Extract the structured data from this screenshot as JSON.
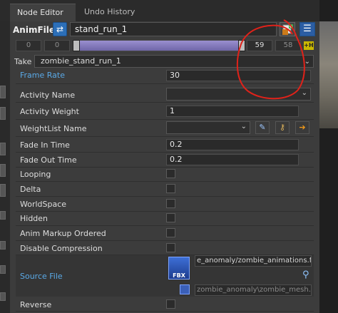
{
  "tabs": [
    {
      "label": "Node Editor"
    },
    {
      "label": "Undo History"
    }
  ],
  "anim": {
    "label": "AnimFile",
    "name": "stand_run_1"
  },
  "timeline": {
    "start_a": "0",
    "start_b": "0",
    "end_a": "59",
    "end_b": "58",
    "badge": "+H"
  },
  "take": {
    "label": "Take",
    "value": "zombie_stand_run_1"
  },
  "properties": {
    "frame_rate": {
      "label": "Frame Rate",
      "value": "30"
    },
    "activity_name": {
      "label": "Activity Name",
      "value": ""
    },
    "activity_weight": {
      "label": "Activity Weight",
      "value": "1"
    },
    "weightlist_name": {
      "label": "WeightList Name",
      "value": ""
    },
    "fade_in_time": {
      "label": "Fade In Time",
      "value": "0.2"
    },
    "fade_out_time": {
      "label": "Fade Out Time",
      "value": "0.2"
    },
    "looping": {
      "label": "Looping"
    },
    "delta": {
      "label": "Delta"
    },
    "worldspace": {
      "label": "WorldSpace"
    },
    "hidden": {
      "label": "Hidden"
    },
    "anim_markup_ordered": {
      "label": "Anim Markup Ordered"
    },
    "disable_compression": {
      "label": "Disable Compression"
    },
    "source_file": {
      "label": "Source File",
      "value": "e_anomaly/zombie_animations.fbx",
      "secondary": "zombie_anomaly\\zombie_mesh.fbx",
      "icon_text": "FBX"
    },
    "reverse": {
      "label": "Reverse"
    }
  },
  "colors": {
    "accent_blue": "#5aa9e6",
    "annotation_red": "#e0221a"
  }
}
